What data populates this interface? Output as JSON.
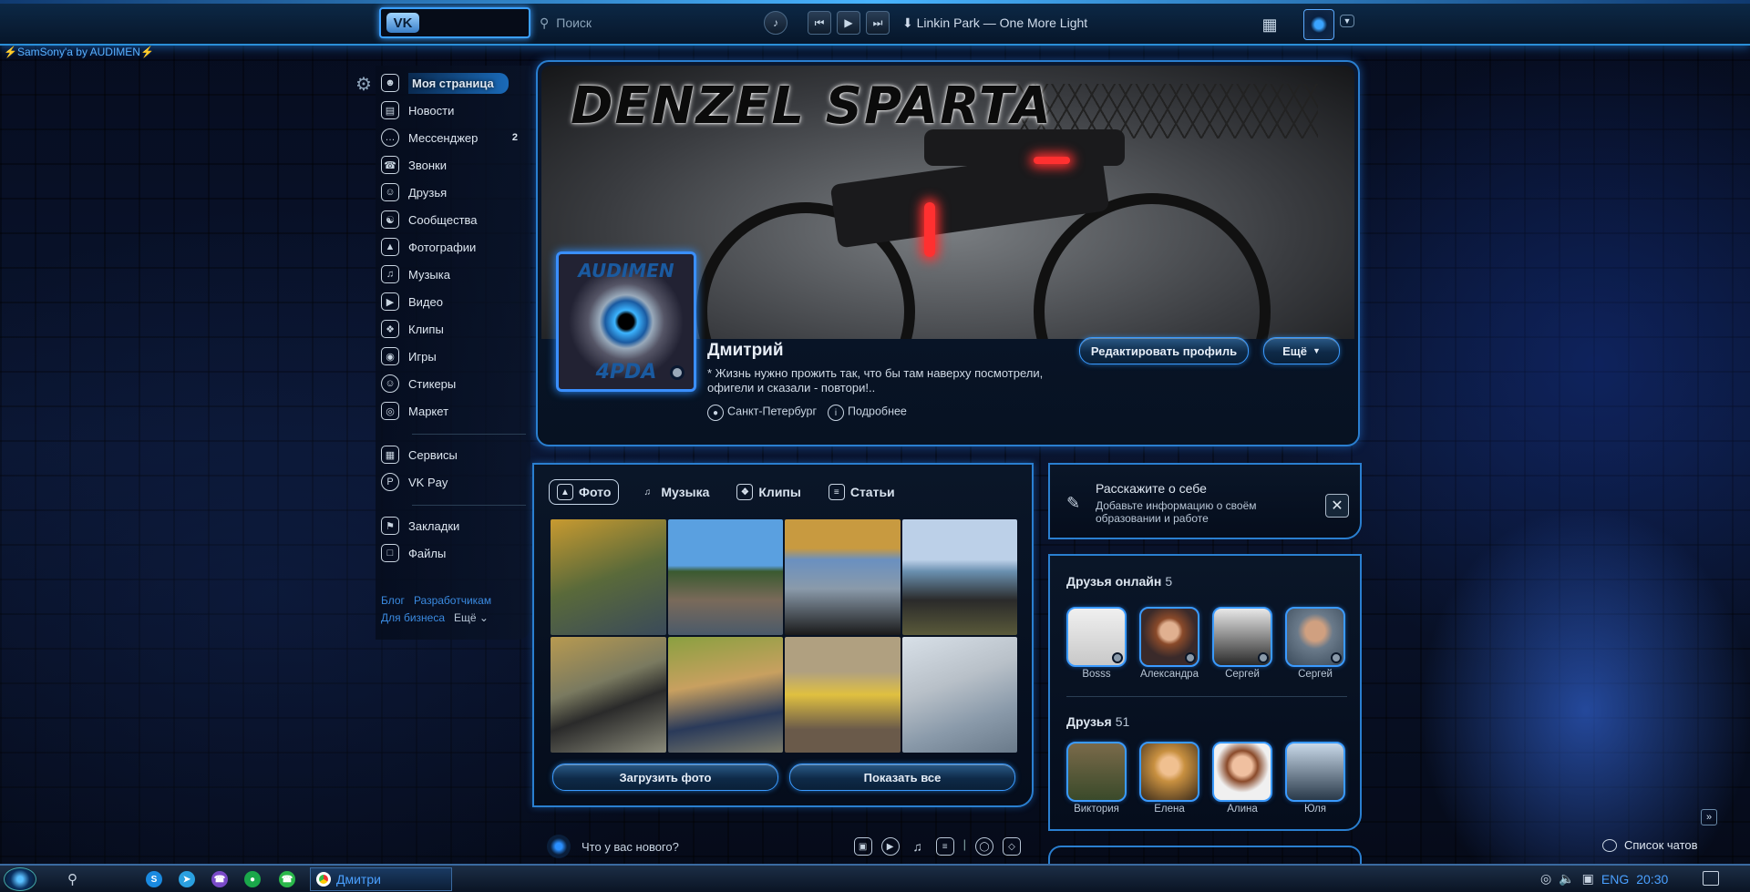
{
  "topbar": {
    "logo_text": "VK",
    "search_placeholder": "Поиск",
    "player": {
      "prev": "⏮",
      "play": "▶",
      "next": "⏭",
      "now_playing": "⬇ Linkin Park — One More Light"
    },
    "icons": [
      "bell-icon",
      "apps-grid-icon",
      "avatar",
      "chevron-down-icon"
    ]
  },
  "theme_label": "⚡SamSony'a by AUDIMEN⚡",
  "nav": {
    "items": [
      {
        "label": "Моя страница",
        "icon": "user-icon",
        "active": true
      },
      {
        "label": "Новости",
        "icon": "news-icon"
      },
      {
        "label": "Мессенджер",
        "icon": "message-icon",
        "badge": "2"
      },
      {
        "label": "Звонки",
        "icon": "phone-icon"
      },
      {
        "label": "Друзья",
        "icon": "friends-icon"
      },
      {
        "label": "Сообщества",
        "icon": "communities-icon"
      },
      {
        "label": "Фотографии",
        "icon": "photo-icon"
      },
      {
        "label": "Музыка",
        "icon": "music-icon"
      },
      {
        "label": "Видео",
        "icon": "video-icon"
      },
      {
        "label": "Клипы",
        "icon": "clips-icon"
      },
      {
        "label": "Игры",
        "icon": "games-icon"
      },
      {
        "label": "Стикеры",
        "icon": "stickers-icon"
      },
      {
        "label": "Маркет",
        "icon": "market-icon"
      },
      {
        "label": "Сервисы",
        "icon": "services-icon"
      },
      {
        "label": "VK Pay",
        "icon": "vkpay-icon"
      },
      {
        "label": "Закладки",
        "icon": "bookmark-icon"
      },
      {
        "label": "Файлы",
        "icon": "files-icon"
      }
    ],
    "footer": {
      "blog": "Блог",
      "dev": "Разработчикам",
      "business": "Для бизнеса",
      "more": "Ещё ⌄"
    }
  },
  "profile": {
    "cover_title": "DENZEL SPARTA",
    "avatar_text_top": "AUDIMEN",
    "avatar_text_bottom": "4PDA",
    "name": "Дмитрий",
    "status": "* Жизнь нужно прожить так, что бы там наверху посмотрели, офигели и сказали - повтори!..",
    "city": "Санкт-Петербург",
    "details": "Подробнее",
    "edit_button": "Редактировать профиль",
    "more_button": "Ещё"
  },
  "media": {
    "tabs": [
      {
        "label": "Фото",
        "icon": "photo-icon",
        "active": true
      },
      {
        "label": "Музыка",
        "icon": "music-icon"
      },
      {
        "label": "Клипы",
        "icon": "clips-icon"
      },
      {
        "label": "Статьи",
        "icon": "articles-icon"
      }
    ],
    "upload_button": "Загрузить фото",
    "show_all_button": "Показать все"
  },
  "composer": {
    "placeholder": "Что у вас нового?"
  },
  "about": {
    "title": "Расскажите о себе",
    "subtitle": "Добавьте информацию о своём образовании и работе",
    "close": "✕"
  },
  "friends": {
    "online_label": "Друзья онлайн",
    "online_count": "5",
    "online": [
      {
        "name": "Bosss"
      },
      {
        "name": "Александра"
      },
      {
        "name": "Сергей"
      },
      {
        "name": "Сергей"
      }
    ],
    "all_label": "Друзья",
    "all_count": "51",
    "all": [
      {
        "name": "Виктория"
      },
      {
        "name": "Елена"
      },
      {
        "name": "Алина"
      },
      {
        "name": "Юля"
      }
    ]
  },
  "chat_list": "Список чатов",
  "taskbar": {
    "chrome_tab": "Дмитри",
    "lang": "ENG",
    "time": "20:30"
  }
}
